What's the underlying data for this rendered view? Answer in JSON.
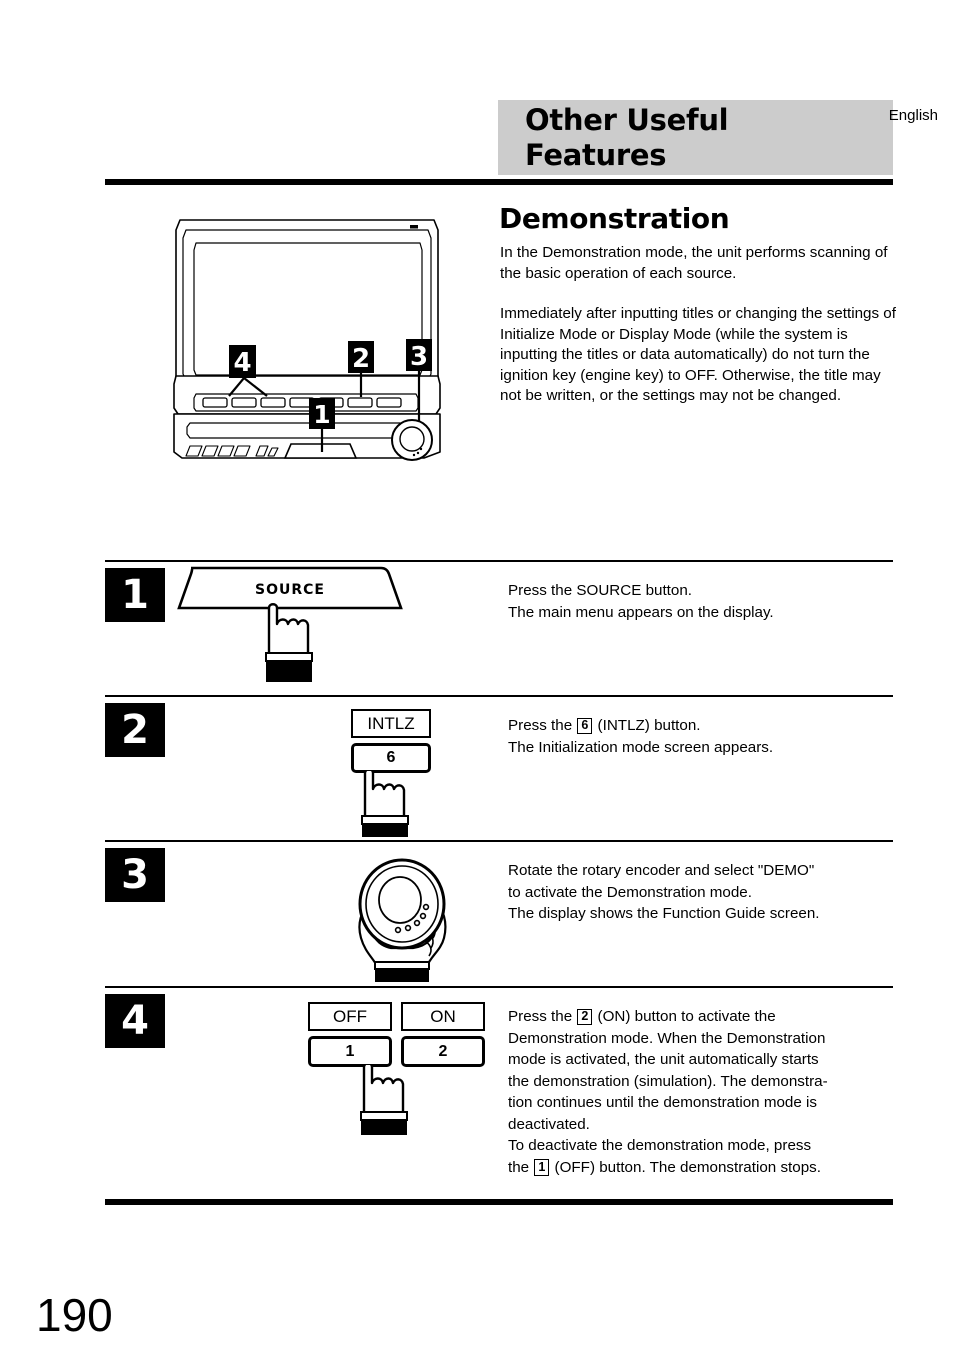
{
  "header": {
    "title": "Other Useful\nFeatures",
    "title_line1": "Other Useful",
    "title_line2": "Features",
    "language": "English",
    "band_color": "#cccccc"
  },
  "section": {
    "title": "Demonstration",
    "paragraph1": "In the Demonstration mode, the unit performs scanning of the basic operation of each source.",
    "paragraph2": "Immediately after inputting titles or changing the settings of Initialize Mode or Display Mode (while the system is inputting the titles or data automatically) do not turn the ignition key (engine key) to OFF. Otherwise, the title may not be written, or the settings may not be changed."
  },
  "device_figure": {
    "name": "car-audio-head-unit-diagram",
    "callouts": [
      {
        "label": "4",
        "target": "preset-buttons-left"
      },
      {
        "label": "2",
        "target": "preset-button-six"
      },
      {
        "label": "3",
        "target": "rotary-encoder"
      },
      {
        "label": "1",
        "target": "source-button"
      }
    ]
  },
  "steps": [
    {
      "number": "1",
      "figure": {
        "type": "source-button",
        "button_label": "SOURCE",
        "hand": "pointing-finger"
      },
      "text_lines": [
        "Press the SOURCE button.",
        "The main menu appears on the display."
      ]
    },
    {
      "number": "2",
      "figure": {
        "type": "labeled-key",
        "display_label": "INTLZ",
        "key_label": "6",
        "hand": "pointing-finger"
      },
      "text_lines": [
        "Press the 6 (INTLZ) button.",
        "The Initialization mode screen appears."
      ],
      "inline_keys": [
        "6"
      ]
    },
    {
      "number": "3",
      "figure": {
        "type": "rotary-encoder",
        "hand": "gripping-hand"
      },
      "text_lines": [
        "Rotate the rotary encoder and select \"DEMO\"",
        "to activate the Demonstration mode.",
        "The display shows the Function Guide screen."
      ]
    },
    {
      "number": "4",
      "figure": {
        "type": "two-labeled-keys",
        "keys": [
          {
            "display_label": "OFF",
            "key_label": "1"
          },
          {
            "display_label": "ON",
            "key_label": "2"
          }
        ],
        "hand": "pointing-finger"
      },
      "text_lines": [
        "Press the 2 (ON) button to activate the",
        "Demonstration mode. When the Demonstration",
        "mode is activated, the unit automatically starts",
        "the demonstration (simulation). The demonstra-",
        "tion continues until the demonstration mode is",
        "deactivated.",
        "To deactivate the demonstration mode, press",
        "the 1 (OFF) button. The demonstration stops."
      ],
      "inline_keys": [
        "2",
        "1"
      ]
    }
  ],
  "footer": {
    "page_number": "190"
  }
}
